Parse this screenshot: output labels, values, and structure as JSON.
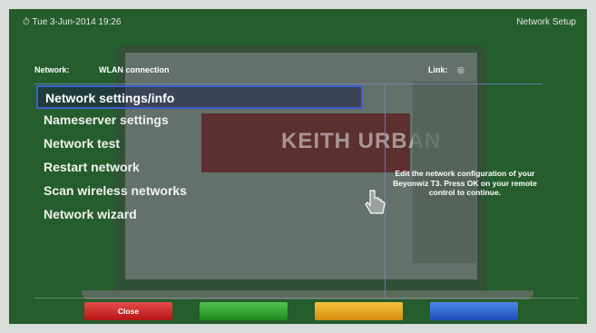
{
  "header": {
    "clock": "⏱ Tue  3-Jun-2014 19:26",
    "title": "Network Setup"
  },
  "status": {
    "network_label": "Network:",
    "network_value": "WLAN connection",
    "link_label": "Link:",
    "link_value": "◎"
  },
  "menu": {
    "items": [
      {
        "label": "Network settings/info",
        "selected": true
      },
      {
        "label": "Nameserver settings"
      },
      {
        "label": "Network test"
      },
      {
        "label": "Restart network"
      },
      {
        "label": "Scan wireless networks"
      },
      {
        "label": "Network wizard"
      }
    ]
  },
  "description": "Edit the network configuration of your Beyonwiz T3. Press OK on your remote control to continue.",
  "background_image": {
    "banner_text": "KEITH URBAN"
  },
  "buttons": {
    "red": "Close",
    "green": "",
    "yellow": "",
    "blue": ""
  },
  "colors": {
    "background": "#255d2d",
    "selection_border": "#3d5fcf",
    "red": "#d12a2a",
    "green": "#32a832",
    "yellow": "#eea726",
    "blue": "#3366d1"
  }
}
